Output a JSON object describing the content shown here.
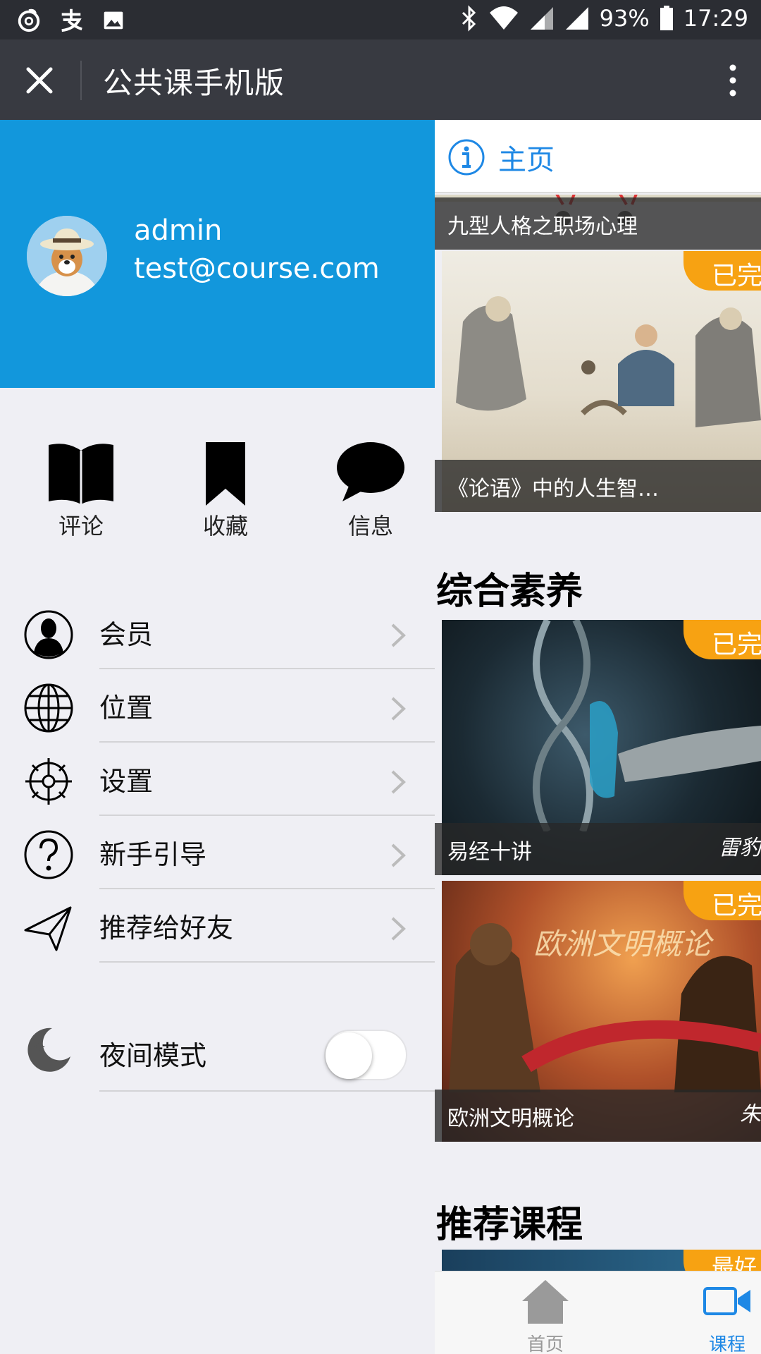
{
  "status_bar": {
    "left_icons": [
      "netease-music-icon",
      "alipay-icon",
      "gallery-icon"
    ],
    "battery": "93%",
    "time": "17:29"
  },
  "title_bar": {
    "title": "公共课手机版"
  },
  "drawer": {
    "profile": {
      "username": "admin",
      "email": "test@course.com"
    },
    "quick_actions": [
      {
        "label": "评论",
        "icon": "book-icon"
      },
      {
        "label": "收藏",
        "icon": "bookmark-icon"
      },
      {
        "label": "信息",
        "icon": "chat-bubble-icon"
      }
    ],
    "menu": [
      {
        "label": "会员",
        "icon": "user-icon"
      },
      {
        "label": "位置",
        "icon": "globe-icon"
      },
      {
        "label": "设置",
        "icon": "gear-icon"
      },
      {
        "label": "新手引导",
        "icon": "help-icon"
      },
      {
        "label": "推荐给好友",
        "icon": "send-icon"
      }
    ],
    "night_mode": {
      "label": "夜间模式",
      "enabled": false
    }
  },
  "main": {
    "nav_label": "主页",
    "cards_top": [
      {
        "title": "九型人格之职场心理"
      },
      {
        "title": "《论语》中的人生智…",
        "badge": "已完结"
      }
    ],
    "section_general": "综合素养",
    "cards_general": [
      {
        "title": "易经十讲",
        "author": "雷豹",
        "badge": "已完结"
      },
      {
        "title": "欧洲文明概论",
        "author": "朱",
        "badge": "已完结",
        "image_text": "欧洲文明概论"
      }
    ],
    "section_recommend": "推荐课程",
    "recommend_badge": "最好",
    "tabs": [
      {
        "label": "首页",
        "icon": "home-icon"
      },
      {
        "label": "课程",
        "icon": "video-camera-icon"
      }
    ]
  },
  "colors": {
    "accent": "#1297dc",
    "badge": "#f7a212",
    "titlebar": "#383a41",
    "statusbar": "#2b2d33"
  }
}
